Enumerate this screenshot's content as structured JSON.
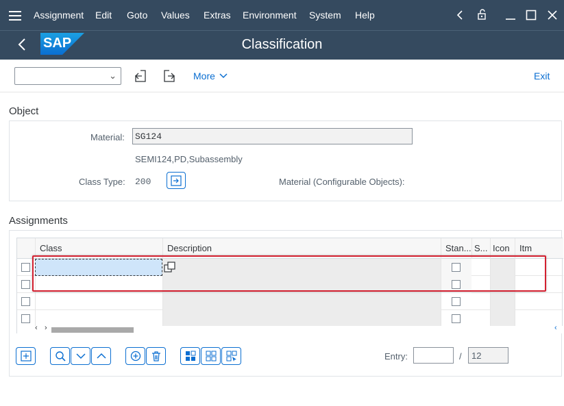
{
  "menubar": {
    "items": [
      "Assignment",
      "Edit",
      "Goto",
      "Values",
      "Extras",
      "Environment",
      "System",
      "Help"
    ]
  },
  "titlebar": {
    "logo": "SAP",
    "title": "Classification"
  },
  "toolbar": {
    "dropdown_value": "",
    "more_label": "More",
    "exit_label": "Exit"
  },
  "object": {
    "section_title": "Object",
    "material_label": "Material:",
    "material_value": "SG124",
    "material_desc": "SEMI124,PD,Subassembly",
    "class_type_label": "Class Type:",
    "class_type_value": "200",
    "configurable_label": "Material (Configurable Objects):"
  },
  "assignments": {
    "section_title": "Assignments",
    "columns": [
      "Class",
      "Description",
      "Stan...",
      "S...",
      "Icon",
      "Itm"
    ],
    "rows": [
      {
        "class": "",
        "description": "",
        "stan": false
      },
      {
        "class": "",
        "description": "",
        "stan": false
      },
      {
        "class": "",
        "description": "",
        "stan": false
      },
      {
        "class": "",
        "description": "",
        "stan": false
      }
    ]
  },
  "footer": {
    "entry_label": "Entry:",
    "entry_value": "",
    "separator": "/",
    "total": "12"
  },
  "colors": {
    "shell": "#354a5f",
    "accent": "#0a6ed1",
    "highlight": "#d32030",
    "selection": "#cfe5fa"
  }
}
